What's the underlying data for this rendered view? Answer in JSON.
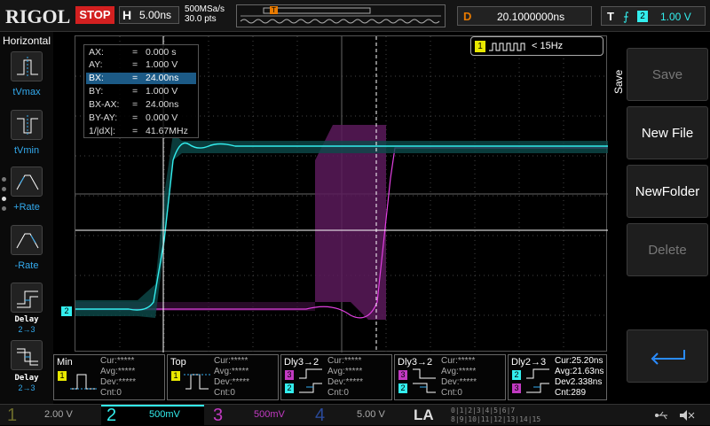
{
  "top": {
    "brand": "RIGOL",
    "run_state": "STOP",
    "h_letter": "H",
    "timebase": "5.00ns",
    "sample_rate": "500MSa/s",
    "mem_depth": "30.0 pts",
    "mem_marker": "T",
    "delay_letter": "D",
    "delay_value": "20.1000000ns",
    "trig_letter": "T",
    "trig_source": "2",
    "trig_level": "1.00 V"
  },
  "left": {
    "title": "Horizontal",
    "items": [
      {
        "label": "tVmax"
      },
      {
        "label": "tVmin"
      },
      {
        "label": "+Rate"
      },
      {
        "label": "-Rate"
      },
      {
        "label1": "Delay",
        "label2": "2→3"
      },
      {
        "label1": "Delay",
        "label2": "2→3"
      }
    ]
  },
  "measure": {
    "rows": [
      {
        "label": "AX:",
        "value": "0.000 s"
      },
      {
        "label": "AY:",
        "value": "1.000 V"
      },
      {
        "label": "BX:",
        "value": "24.00ns"
      },
      {
        "label": "BY:",
        "value": "1.000 V"
      },
      {
        "label": "BX-AX:",
        "value": "24.00ns"
      },
      {
        "label": "BY-AY:",
        "value": "0.000 V"
      },
      {
        "label": "1/|dX|:",
        "value": "41.67MHz"
      }
    ],
    "eq": "="
  },
  "counter": {
    "source": "1",
    "value": "< 15Hz"
  },
  "right": {
    "title": "Save",
    "buttons": [
      "Save",
      "New File",
      "NewFolder",
      "Delete"
    ]
  },
  "measurements": [
    {
      "name": "Min",
      "src": "1",
      "cur": "Cur:*****",
      "avg": "Avg:*****",
      "dev": "Dev:*****",
      "cnt": "Cnt:0"
    },
    {
      "name": "Top",
      "src": "1",
      "cur": "Cur:*****",
      "avg": "Avg:*****",
      "dev": "Dev:*****",
      "cnt": "Cnt:0"
    },
    {
      "name": "Dly3→2",
      "src1": "3",
      "src2": "2",
      "cur": "Cur:*****",
      "avg": "Avg:*****",
      "dev": "Dev:*****",
      "cnt": "Cnt:0"
    },
    {
      "name": "Dly3→2",
      "src1": "3",
      "src2": "2",
      "cur": "Cur:*****",
      "avg": "Avg:*****",
      "dev": "Dev:*****",
      "cnt": "Cnt:0"
    },
    {
      "name": "Dly2→3",
      "src1": "2",
      "src2": "3",
      "cur": "Cur:25.20ns",
      "avg": "Avg:21.63ns",
      "dev": "Dev2.338ns",
      "cnt": "Cnt:289"
    }
  ],
  "channels": [
    {
      "num": "1",
      "scale": "2.00 V",
      "color": "#e8e800"
    },
    {
      "num": "2",
      "scale": "500mV",
      "color": "#3ee"
    },
    {
      "num": "3",
      "scale": "500mV",
      "color": "#c23ac2"
    },
    {
      "num": "4",
      "scale": "5.00 V",
      "color": "#2a5ce8"
    }
  ],
  "la": {
    "label": "LA",
    "row1": "0|1|2|3|4|5|6|7",
    "row2": "8|9|10|11|12|13|14|15"
  },
  "markers": {
    "ch2": "2",
    "trig": "T"
  }
}
